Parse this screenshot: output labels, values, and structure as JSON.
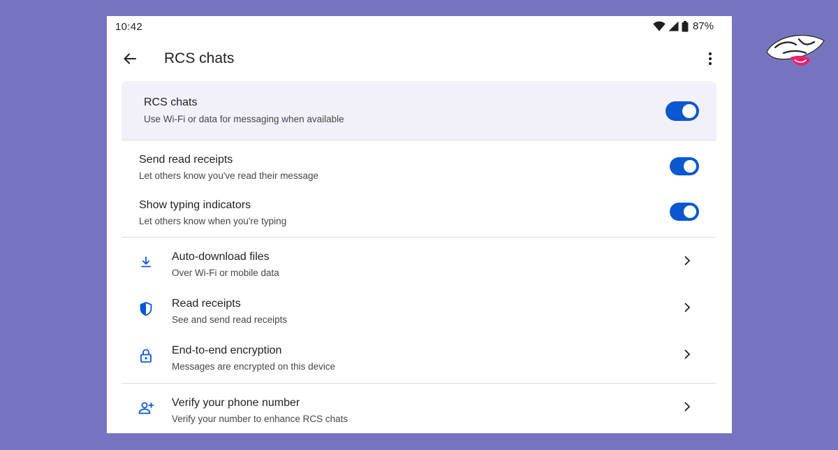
{
  "status_bar": {
    "time": "10:42",
    "battery": "87%",
    "icons": [
      "wifi-icon",
      "signal-icon",
      "battery-icon"
    ]
  },
  "app_bar": {
    "title": "RCS chats",
    "back_icon": "arrow-back-icon",
    "more_icon": "more-vert-icon"
  },
  "main_toggle": {
    "title": "RCS chats",
    "subtitle": "Use Wi-Fi or data for messaging when available",
    "enabled": true
  },
  "toggles": [
    {
      "title": "Send read receipts",
      "subtitle": "Let others know you've read their message",
      "enabled": true
    },
    {
      "title": "Show typing indicators",
      "subtitle": "Let others know when you're typing",
      "enabled": true
    }
  ],
  "nav_items": [
    {
      "title": "Auto-download files",
      "subtitle": "Over Wi-Fi or mobile data",
      "icon": "download-icon"
    },
    {
      "title": "Read receipts",
      "subtitle": "See and send read receipts",
      "icon": "shield-icon"
    },
    {
      "title": "End-to-end encryption",
      "subtitle": "Messages are encrypted on this device",
      "icon": "lock-icon"
    }
  ],
  "verify_item": {
    "title": "Verify your phone number",
    "subtitle": "Verify your number to enhance RCS chats",
    "icon": "person-add-icon"
  },
  "colors": {
    "background": "#7774bf",
    "accent": "#0b57d0",
    "card": "#f2f1f9",
    "icon": "#0b57d0"
  }
}
